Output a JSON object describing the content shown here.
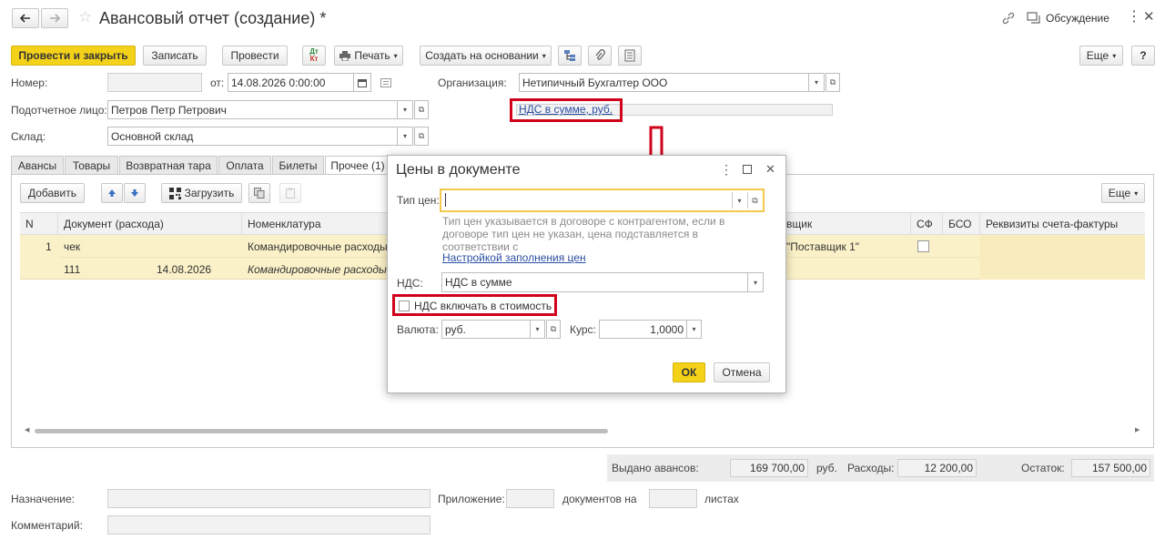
{
  "window": {
    "title": "Авансовый отчет (создание) *",
    "discussion_label": "Обсуждение"
  },
  "toolbar": {
    "post_close": "Провести и закрыть",
    "save": "Записать",
    "post": "Провести",
    "print": "Печать",
    "create_based": "Создать на основании",
    "more": "Еще",
    "help": "?"
  },
  "header": {
    "number_label": "Номер:",
    "number_value": "",
    "date_label": "от:",
    "date_value": "14.08.2026  0:00:00",
    "org_label": "Организация:",
    "org_value": "Нетипичный Бухгалтер ООО",
    "person_label": "Подотчетное лицо:",
    "person_value": "Петров Петр Петрович",
    "vat_link": "НДС в сумме, руб.",
    "warehouse_label": "Склад:",
    "warehouse_value": "Основной склад"
  },
  "tabs": [
    "Авансы",
    "Товары",
    "Возвратная тара",
    "Оплата",
    "Билеты",
    "Прочее (1)"
  ],
  "table_toolbar": {
    "add": "Добавить",
    "load": "Загрузить",
    "more": "Еще"
  },
  "table": {
    "columns": [
      "N",
      "Документ (расхода)",
      "Номенклатура",
      "вщик",
      "СФ",
      "БСО",
      "Реквизиты счета-фактуры"
    ],
    "rows": [
      {
        "n": "1",
        "doc": "чек",
        "doc_number": "111",
        "doc_date": "14.08.2026",
        "item": "Командировочные расходы",
        "item2": "Командировочные расходы",
        "supplier": "\"Поставщик 1\""
      }
    ]
  },
  "totals": {
    "advances_label": "Выдано авансов:",
    "advances_value": "169 700,00",
    "currency": "руб.",
    "expenses_label": "Расходы:",
    "expenses_value": "12 200,00",
    "remainder_label": "Остаток:",
    "remainder_value": "157 500,00"
  },
  "footer": {
    "purpose_label": "Назначение:",
    "attachment_label": "Приложение:",
    "docs_on": "документов на",
    "sheets": "листах",
    "comment_label": "Комментарий:"
  },
  "dialog": {
    "title": "Цены в документе",
    "price_type_label": "Тип цен:",
    "price_type_value": "",
    "hint": "Тип цен указывается в договоре с контрагентом, если в договоре тип цен не указан, цена подставляется в соответствии с",
    "settings_link": "Настройкой заполнения цен",
    "vat_label": "НДС:",
    "vat_value": "НДС в сумме",
    "include_vat_label": "НДС включать в стоимость",
    "include_vat_checked": false,
    "currency_label": "Валюта:",
    "currency_value": "руб.",
    "rate_label": "Курс:",
    "rate_value": "1,0000",
    "ok": "ОК",
    "cancel": "Отмена"
  },
  "colors": {
    "accent_yellow": "#f5d21a",
    "highlight_red": "#d0021b",
    "row_selected": "#fbf1c8",
    "link_blue": "#2b4ea3"
  }
}
